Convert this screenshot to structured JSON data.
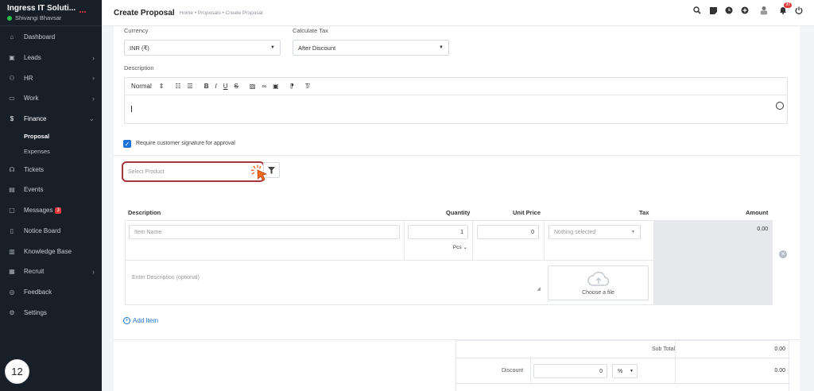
{
  "sidebar": {
    "company": "Ingress IT Soluti...",
    "user": "Shivangi Bhavsar",
    "items": [
      {
        "label": "Dashboard",
        "icon": "home-icon"
      },
      {
        "label": "Leads",
        "icon": "leads-icon"
      },
      {
        "label": "HR",
        "icon": "users-icon"
      },
      {
        "label": "Work",
        "icon": "briefcase-icon"
      },
      {
        "label": "Finance",
        "icon": "dollar-icon"
      },
      {
        "label": "Tickets",
        "icon": "headset-icon"
      },
      {
        "label": "Events",
        "icon": "calendar-icon"
      },
      {
        "label": "Messages",
        "icon": "message-icon",
        "badge": "3"
      },
      {
        "label": "Notice Board",
        "icon": "notice-icon"
      },
      {
        "label": "Knowledge Base",
        "icon": "book-icon"
      },
      {
        "label": "Recruit",
        "icon": "recruit-icon"
      },
      {
        "label": "Feedback",
        "icon": "feedback-icon"
      },
      {
        "label": "Settings",
        "icon": "gear-icon"
      }
    ],
    "finance_sub": [
      "Proposal",
      "Expenses"
    ],
    "step": "12"
  },
  "topbar": {
    "title": "Create Proposal",
    "breadcrumb": "Home • Proposals • Create Proposal",
    "notif_count": "90"
  },
  "form": {
    "currency_label": "Currency",
    "currency_value": "INR (₹)",
    "calc_tax_label": "Calculate Tax",
    "calc_tax_value": "After Discount",
    "description_label": "Description",
    "editor_format": "Normal",
    "signature_label": "Require customer signature for approval",
    "product_placeholder": "Select Product"
  },
  "items_table": {
    "headers": {
      "description": "Description",
      "quantity": "Quantity",
      "unit_price": "Unit Price",
      "tax": "Tax",
      "amount": "Amount"
    },
    "row": {
      "item_name_placeholder": "Item Name",
      "quantity": "1",
      "unit": "Pcs",
      "unit_price": "0",
      "tax_placeholder": "Nothing selected",
      "amount": "0.00",
      "desc_placeholder": "Enter Description (optional)",
      "upload_label": "Choose a file"
    },
    "add_item": "Add Item"
  },
  "totals": {
    "sub_total_label": "Sub Total",
    "sub_total_value": "0.00",
    "discount_label": "Discount",
    "discount_value": "0",
    "discount_type": "%",
    "discount_total": "0.00"
  },
  "colors": {
    "sidebar_bg": "#171f29",
    "accent": "#1d72d8",
    "highlight": "#a6313f"
  }
}
